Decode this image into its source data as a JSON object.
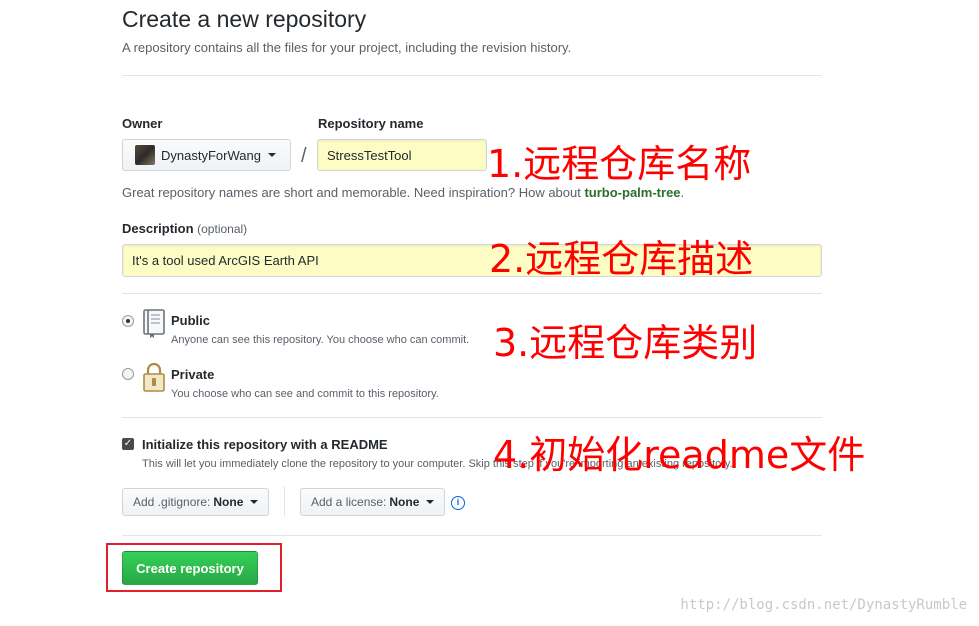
{
  "page": {
    "title": "Create a new repository",
    "subtitle": "A repository contains all the files for your project, including the revision history."
  },
  "owner": {
    "label": "Owner",
    "value": "DynastyForWang"
  },
  "repo_name": {
    "label": "Repository name",
    "value": "StressTestTool",
    "separator": "/"
  },
  "hint": {
    "text": "Great repository names are short and memorable. Need inspiration? How about ",
    "suggestion": "turbo-palm-tree",
    "suffix": "."
  },
  "description": {
    "label": "Description",
    "optional": "(optional)",
    "value": "It's a tool used ArcGIS Earth API"
  },
  "visibility": {
    "public": {
      "title": "Public",
      "desc": "Anyone can see this repository. You choose who can commit.",
      "checked": true
    },
    "private": {
      "title": "Private",
      "desc": "You choose who can see and commit to this repository.",
      "checked": false
    }
  },
  "readme": {
    "title": "Initialize this repository with a README",
    "desc": "This will let you immediately clone the repository to your computer. Skip this step if you're importing an existing repository.",
    "checked": true
  },
  "gitignore": {
    "label": "Add .gitignore:",
    "value": "None"
  },
  "license": {
    "label": "Add a license:",
    "value": "None"
  },
  "info_icon": "i",
  "create_button": "Create repository",
  "annotations": {
    "a1": "1.远程仓库名称",
    "a2": "2.远程仓库描述",
    "a3": "3.远程仓库类别",
    "a4": "4.初始化readme文件"
  },
  "watermark": "http://blog.csdn.net/DynastyRumble",
  "colors": {
    "create_button": "#2ea44f",
    "annotation": "#ff0000",
    "input_highlight": "#fcfcc4",
    "highlight_box": "#e0202a",
    "suggestion": "#2c6e2e"
  },
  "icons": {
    "public": "book-icon",
    "private": "lock-icon",
    "info": "info-icon",
    "caret": "caret-down-icon"
  }
}
